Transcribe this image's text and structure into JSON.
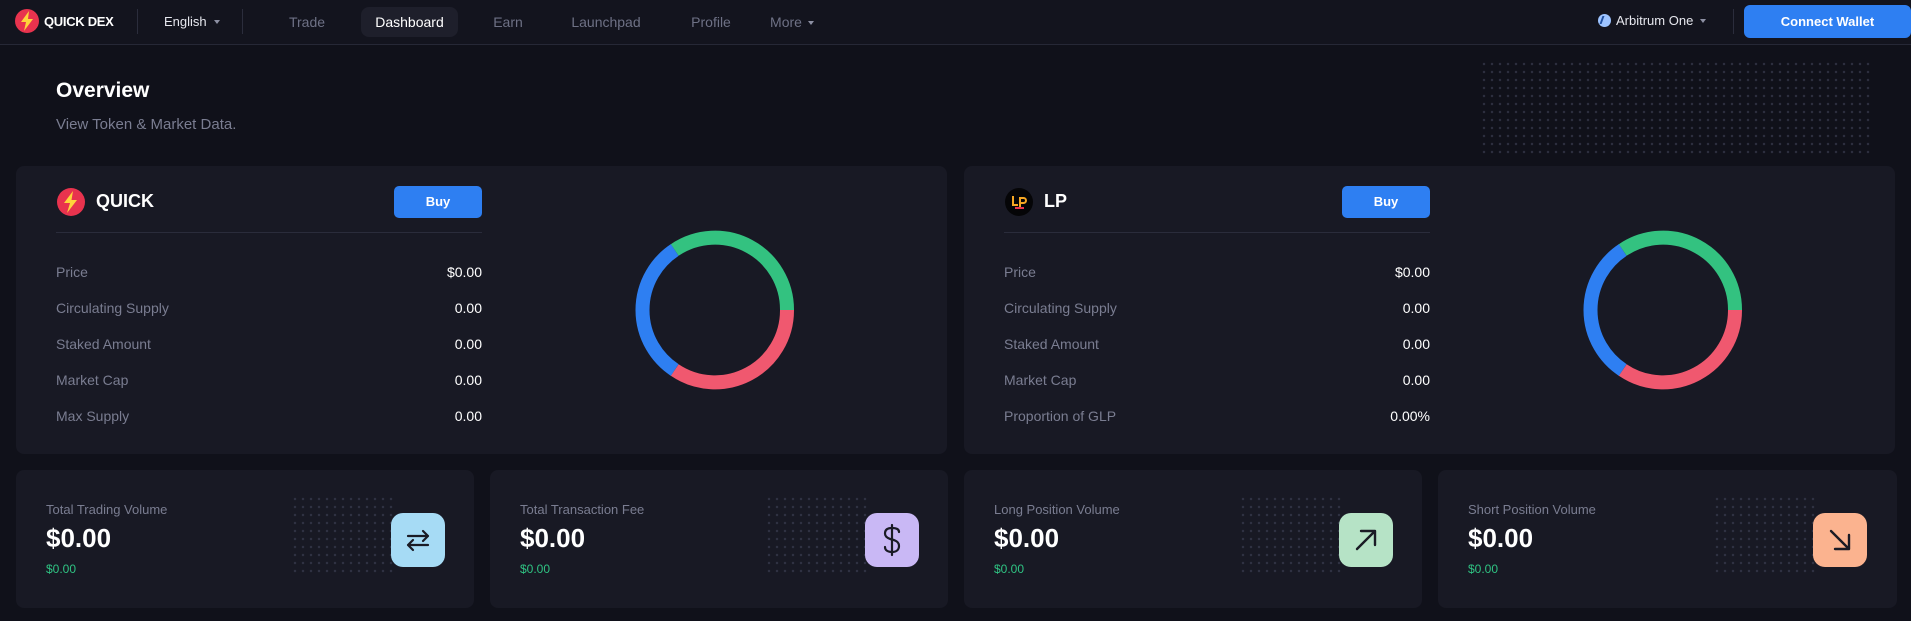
{
  "header": {
    "logo_text": "QUICK DEX",
    "language": "English",
    "nav": [
      {
        "label": "Trade",
        "active": false
      },
      {
        "label": "Dashboard",
        "active": true
      },
      {
        "label": "Earn",
        "active": false
      },
      {
        "label": "Launchpad",
        "active": false
      },
      {
        "label": "Profile",
        "active": false
      },
      {
        "label": "More",
        "active": false
      }
    ],
    "network": "Arbitrum One",
    "connect_label": "Connect Wallet"
  },
  "overview": {
    "title": "Overview",
    "subtitle": "View Token & Market Data."
  },
  "tokens": [
    {
      "name": "QUICK",
      "buy_label": "Buy",
      "stats": [
        {
          "label": "Price",
          "value": "$0.00"
        },
        {
          "label": "Circulating Supply",
          "value": "0.00"
        },
        {
          "label": "Staked Amount",
          "value": "0.00"
        },
        {
          "label": "Market Cap",
          "value": "0.00"
        },
        {
          "label": "Max Supply",
          "value": "0.00"
        }
      ]
    },
    {
      "name": "LP",
      "logo_text": "LP",
      "buy_label": "Buy",
      "stats": [
        {
          "label": "Price",
          "value": "$0.00"
        },
        {
          "label": "Circulating Supply",
          "value": "0.00"
        },
        {
          "label": "Staked Amount",
          "value": "0.00"
        },
        {
          "label": "Market Cap",
          "value": "0.00"
        },
        {
          "label": "Proportion of GLP",
          "value": "0.00%"
        }
      ]
    }
  ],
  "donut_colors": {
    "green": "#33c280",
    "red": "#f0586f",
    "blue": "#2e7ff2"
  },
  "metrics": [
    {
      "label": "Total Trading Volume",
      "value": "$0.00",
      "sub": "$0.00",
      "icon": "swap-arrows-icon",
      "icon_bg": "#a6dbf5"
    },
    {
      "label": "Total Transaction Fee",
      "value": "$0.00",
      "sub": "$0.00",
      "icon": "dollar-icon",
      "icon_bg": "#c9b8f5"
    },
    {
      "label": "Long Position Volume",
      "value": "$0.00",
      "sub": "$0.00",
      "icon": "arrow-up-right-icon",
      "icon_bg": "#b6e3c6"
    },
    {
      "label": "Short Position Volume",
      "value": "$0.00",
      "sub": "$0.00",
      "icon": "arrow-down-right-icon",
      "icon_bg": "#fbb38f"
    }
  ]
}
